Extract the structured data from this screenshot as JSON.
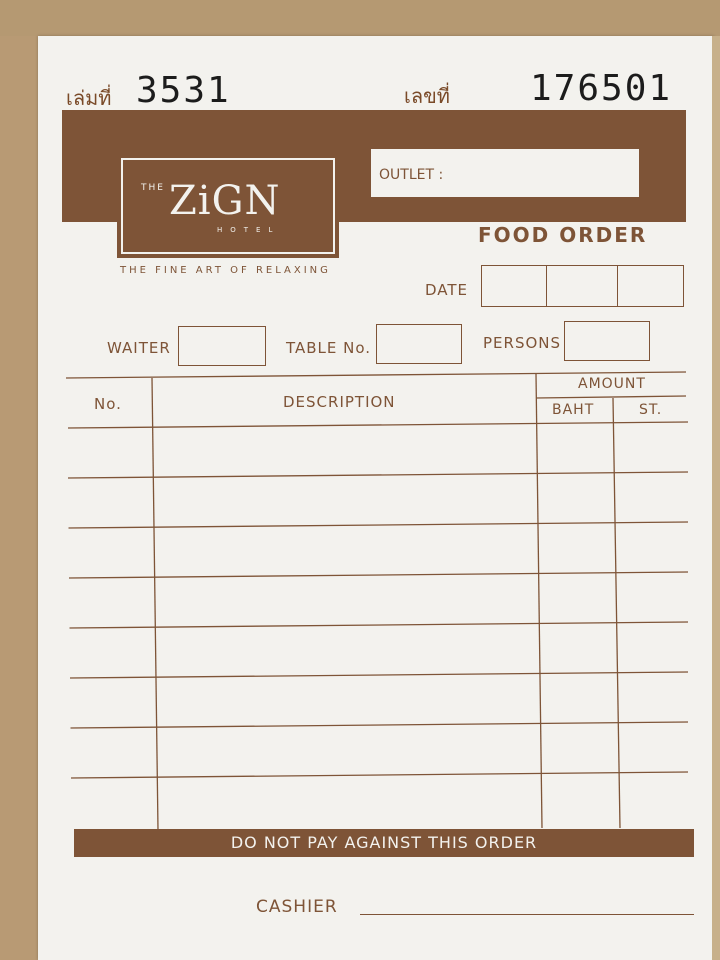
{
  "header": {
    "book_label": "เล่มที่",
    "book_number": "3531",
    "serial_label": "เลขที่",
    "serial_number": "176501"
  },
  "brand": {
    "prefix": "THE",
    "name": "ZiGN",
    "sub": "HOTEL",
    "tagline": "THE FINE ART OF RELAXING"
  },
  "form": {
    "outlet_label": "OUTLET :",
    "title": "FOOD ORDER",
    "date_label": "DATE",
    "waiter_label": "WAITER",
    "table_label": "TABLE No.",
    "persons_label": "PERSONS"
  },
  "table": {
    "col_no": "No.",
    "col_description": "DESCRIPTION",
    "col_amount": "AMOUNT",
    "col_baht": "BAHT",
    "col_st": "ST.",
    "rows": [
      "",
      "",
      "",
      "",
      "",
      "",
      "",
      ""
    ]
  },
  "footer": {
    "notice": "DO NOT PAY AGAINST THIS ORDER",
    "cashier_label": "CASHIER"
  },
  "colors": {
    "ink": "#7e5437",
    "paper": "#f3f2ee",
    "stamp": "#1c1c1c"
  }
}
